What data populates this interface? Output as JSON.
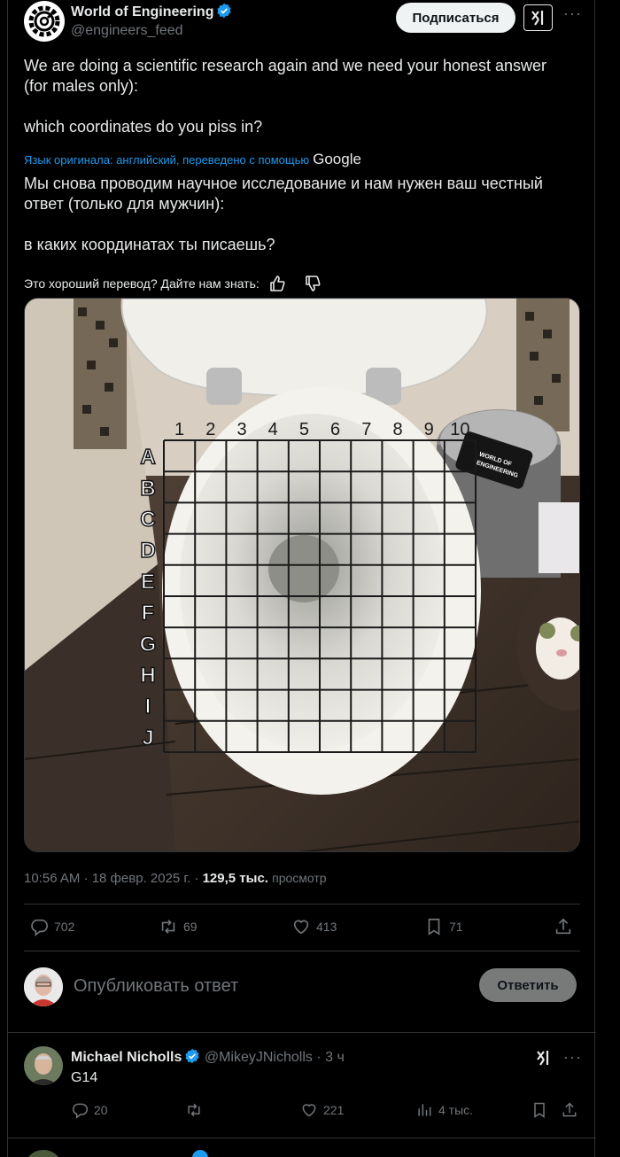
{
  "tweet": {
    "author_name": "World of Engineering",
    "author_handle": "@engineers_feed",
    "subscribe_label": "Подписаться",
    "more_label": "···",
    "text_original": "We are doing a scientific research again and we need your honest answer (for males only):\n\nwhich coordinates do you piss in?",
    "translation_note": "Язык оригинала: английский, переведено с помощью",
    "translation_provider": "Google",
    "text_translated": "Мы снова проводим научное исследование и нам нужен ваш честный ответ (только для мужчин):\n\nв каких координатах ты писаешь?",
    "feedback_prompt": "Это хороший перевод? Дайте нам знать:",
    "timestamp": "10:56 AM · 18 февр. 2025 г. ·",
    "views_count": "129,5 тыс.",
    "views_label": "просмотр",
    "replies": "702",
    "reposts": "69",
    "likes": "413",
    "bookmarks": "71"
  },
  "image": {
    "columns": [
      "1",
      "2",
      "3",
      "4",
      "5",
      "6",
      "7",
      "8",
      "9",
      "10"
    ],
    "rows": [
      "A",
      "B",
      "C",
      "D",
      "E",
      "F",
      "G",
      "H",
      "I",
      "J"
    ],
    "sticker_line1": "WORLD OF",
    "sticker_line2": "ENGINEERING"
  },
  "compose": {
    "placeholder": "Опубликовать ответ",
    "reply_button": "Ответить"
  },
  "reply1": {
    "name": "Michael Nicholls",
    "handle": "@MikeyJNicholls",
    "time": "· 3 ч",
    "text": "G14",
    "replies": "20",
    "likes": "221",
    "views": "4 тыс."
  },
  "colors": {
    "accent": "#1d9bf0",
    "background": "#000000",
    "border": "#2f3336",
    "muted": "#71767b"
  }
}
